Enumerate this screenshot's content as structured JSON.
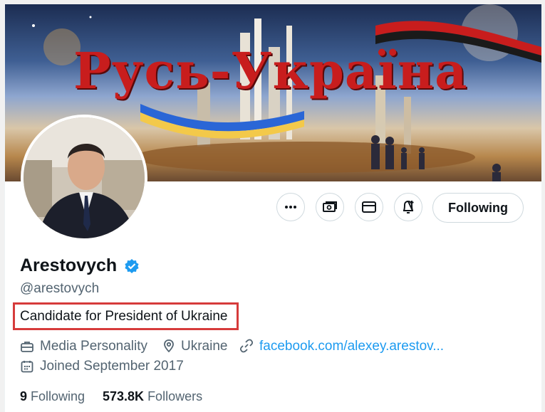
{
  "banner": {
    "title": "Русь-Україна"
  },
  "actions": {
    "following_label": "Following"
  },
  "profile": {
    "name": "Arestovych",
    "handle": "@arestovych",
    "bio": "Candidate for President of Ukraine",
    "category": "Media Personality",
    "location": "Ukraine",
    "website": "facebook.com/alexey.arestov...",
    "joined": "Joined September 2017"
  },
  "stats": {
    "following_count": "9",
    "following_label": "Following",
    "followers_count": "573.8K",
    "followers_label": "Followers"
  },
  "icons": {
    "more": "more-horizontal-icon",
    "subscribe": "money-icon",
    "message": "envelope-icon",
    "notifications": "bell-plus-icon",
    "verified": "verified-badge-icon",
    "category": "briefcase-icon",
    "location": "location-pin-icon",
    "website": "link-icon",
    "joined": "calendar-icon"
  },
  "colors": {
    "accent": "#1d9bf0",
    "text": "#0f1419",
    "muted": "#536471",
    "highlight_box": "#d63b3b"
  }
}
